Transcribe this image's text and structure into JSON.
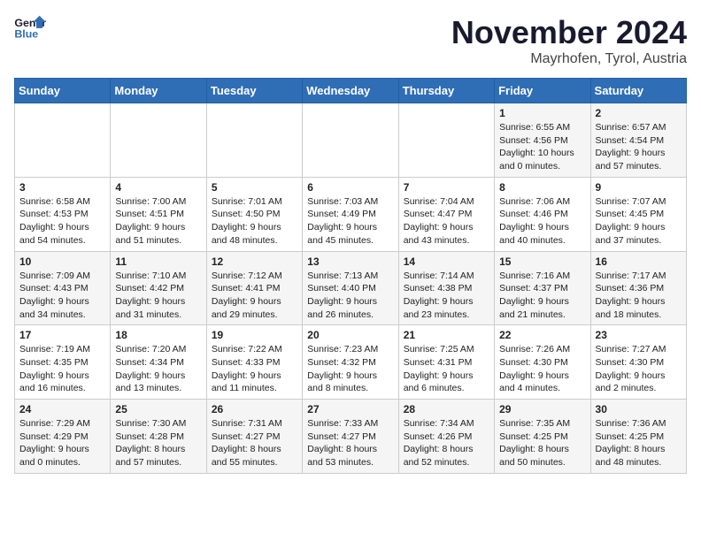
{
  "logo": {
    "line1": "General",
    "line2": "Blue"
  },
  "title": "November 2024",
  "location": "Mayrhofen, Tyrol, Austria",
  "days_of_week": [
    "Sunday",
    "Monday",
    "Tuesday",
    "Wednesday",
    "Thursday",
    "Friday",
    "Saturday"
  ],
  "weeks": [
    [
      {
        "day": "",
        "info": ""
      },
      {
        "day": "",
        "info": ""
      },
      {
        "day": "",
        "info": ""
      },
      {
        "day": "",
        "info": ""
      },
      {
        "day": "",
        "info": ""
      },
      {
        "day": "1",
        "info": "Sunrise: 6:55 AM\nSunset: 4:56 PM\nDaylight: 10 hours and 0 minutes."
      },
      {
        "day": "2",
        "info": "Sunrise: 6:57 AM\nSunset: 4:54 PM\nDaylight: 9 hours and 57 minutes."
      }
    ],
    [
      {
        "day": "3",
        "info": "Sunrise: 6:58 AM\nSunset: 4:53 PM\nDaylight: 9 hours and 54 minutes."
      },
      {
        "day": "4",
        "info": "Sunrise: 7:00 AM\nSunset: 4:51 PM\nDaylight: 9 hours and 51 minutes."
      },
      {
        "day": "5",
        "info": "Sunrise: 7:01 AM\nSunset: 4:50 PM\nDaylight: 9 hours and 48 minutes."
      },
      {
        "day": "6",
        "info": "Sunrise: 7:03 AM\nSunset: 4:49 PM\nDaylight: 9 hours and 45 minutes."
      },
      {
        "day": "7",
        "info": "Sunrise: 7:04 AM\nSunset: 4:47 PM\nDaylight: 9 hours and 43 minutes."
      },
      {
        "day": "8",
        "info": "Sunrise: 7:06 AM\nSunset: 4:46 PM\nDaylight: 9 hours and 40 minutes."
      },
      {
        "day": "9",
        "info": "Sunrise: 7:07 AM\nSunset: 4:45 PM\nDaylight: 9 hours and 37 minutes."
      }
    ],
    [
      {
        "day": "10",
        "info": "Sunrise: 7:09 AM\nSunset: 4:43 PM\nDaylight: 9 hours and 34 minutes."
      },
      {
        "day": "11",
        "info": "Sunrise: 7:10 AM\nSunset: 4:42 PM\nDaylight: 9 hours and 31 minutes."
      },
      {
        "day": "12",
        "info": "Sunrise: 7:12 AM\nSunset: 4:41 PM\nDaylight: 9 hours and 29 minutes."
      },
      {
        "day": "13",
        "info": "Sunrise: 7:13 AM\nSunset: 4:40 PM\nDaylight: 9 hours and 26 minutes."
      },
      {
        "day": "14",
        "info": "Sunrise: 7:14 AM\nSunset: 4:38 PM\nDaylight: 9 hours and 23 minutes."
      },
      {
        "day": "15",
        "info": "Sunrise: 7:16 AM\nSunset: 4:37 PM\nDaylight: 9 hours and 21 minutes."
      },
      {
        "day": "16",
        "info": "Sunrise: 7:17 AM\nSunset: 4:36 PM\nDaylight: 9 hours and 18 minutes."
      }
    ],
    [
      {
        "day": "17",
        "info": "Sunrise: 7:19 AM\nSunset: 4:35 PM\nDaylight: 9 hours and 16 minutes."
      },
      {
        "day": "18",
        "info": "Sunrise: 7:20 AM\nSunset: 4:34 PM\nDaylight: 9 hours and 13 minutes."
      },
      {
        "day": "19",
        "info": "Sunrise: 7:22 AM\nSunset: 4:33 PM\nDaylight: 9 hours and 11 minutes."
      },
      {
        "day": "20",
        "info": "Sunrise: 7:23 AM\nSunset: 4:32 PM\nDaylight: 9 hours and 8 minutes."
      },
      {
        "day": "21",
        "info": "Sunrise: 7:25 AM\nSunset: 4:31 PM\nDaylight: 9 hours and 6 minutes."
      },
      {
        "day": "22",
        "info": "Sunrise: 7:26 AM\nSunset: 4:30 PM\nDaylight: 9 hours and 4 minutes."
      },
      {
        "day": "23",
        "info": "Sunrise: 7:27 AM\nSunset: 4:30 PM\nDaylight: 9 hours and 2 minutes."
      }
    ],
    [
      {
        "day": "24",
        "info": "Sunrise: 7:29 AM\nSunset: 4:29 PM\nDaylight: 9 hours and 0 minutes."
      },
      {
        "day": "25",
        "info": "Sunrise: 7:30 AM\nSunset: 4:28 PM\nDaylight: 8 hours and 57 minutes."
      },
      {
        "day": "26",
        "info": "Sunrise: 7:31 AM\nSunset: 4:27 PM\nDaylight: 8 hours and 55 minutes."
      },
      {
        "day": "27",
        "info": "Sunrise: 7:33 AM\nSunset: 4:27 PM\nDaylight: 8 hours and 53 minutes."
      },
      {
        "day": "28",
        "info": "Sunrise: 7:34 AM\nSunset: 4:26 PM\nDaylight: 8 hours and 52 minutes."
      },
      {
        "day": "29",
        "info": "Sunrise: 7:35 AM\nSunset: 4:25 PM\nDaylight: 8 hours and 50 minutes."
      },
      {
        "day": "30",
        "info": "Sunrise: 7:36 AM\nSunset: 4:25 PM\nDaylight: 8 hours and 48 minutes."
      }
    ]
  ]
}
